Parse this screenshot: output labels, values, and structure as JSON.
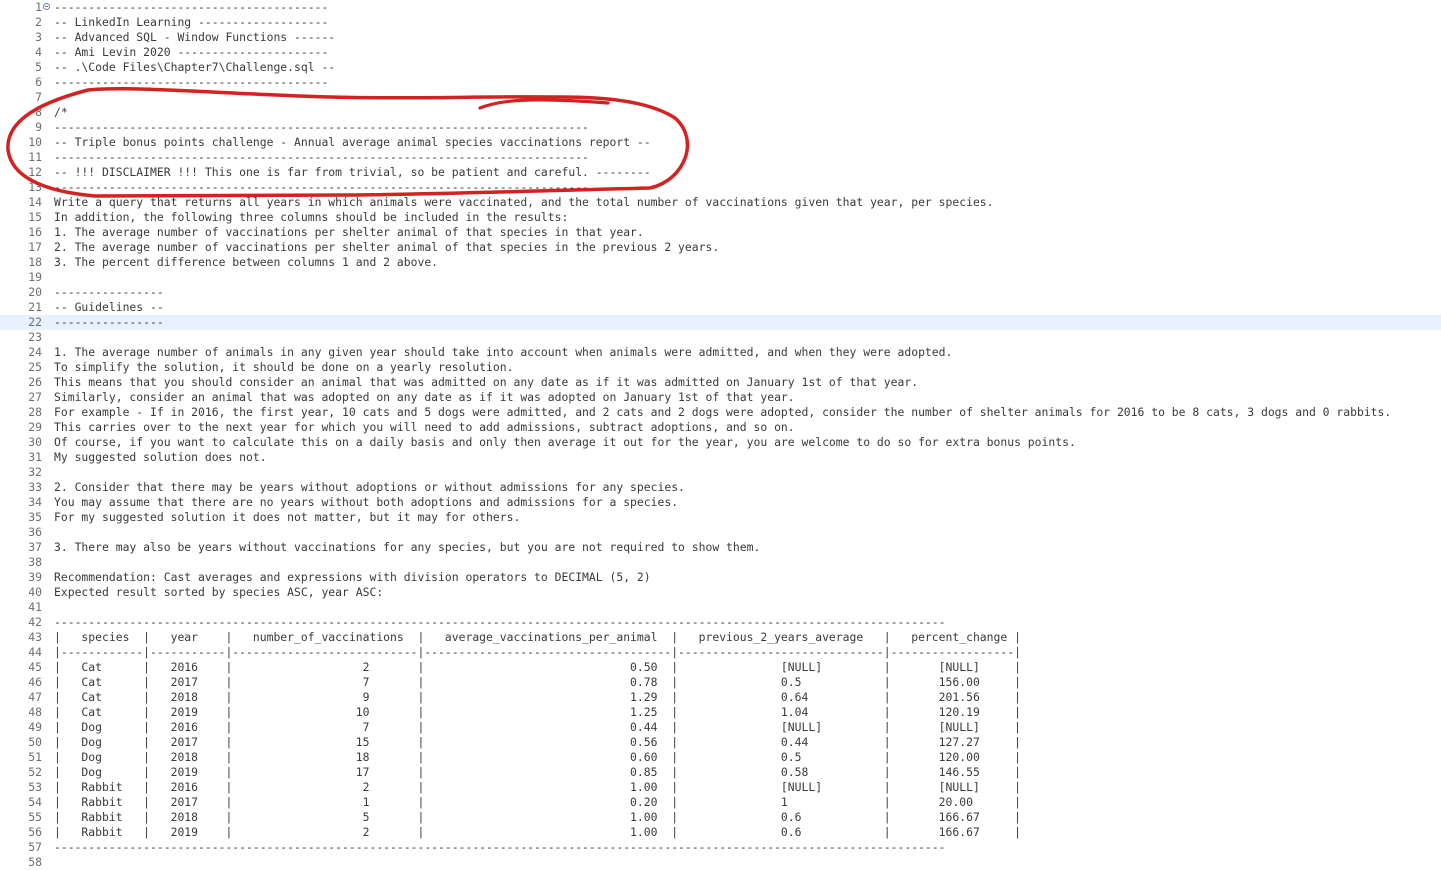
{
  "editor": {
    "fold_marker_line": 1,
    "current_line": 22,
    "lines": [
      {
        "n": "1",
        "text": "----------------------------------------"
      },
      {
        "n": "2",
        "text": "-- LinkedIn Learning -------------------"
      },
      {
        "n": "3",
        "text": "-- Advanced SQL - Window Functions ------"
      },
      {
        "n": "4",
        "text": "-- Ami Levin 2020 ----------------------"
      },
      {
        "n": "5",
        "text": "-- .\\Code Files\\Chapter7\\Challenge.sql --"
      },
      {
        "n": "6",
        "text": "----------------------------------------"
      },
      {
        "n": "7",
        "text": ""
      },
      {
        "n": "8",
        "text": "/*"
      },
      {
        "n": "9",
        "text": "------------------------------------------------------------------------------"
      },
      {
        "n": "10",
        "text": "-- Triple bonus points challenge - Annual average animal species vaccinations report --"
      },
      {
        "n": "11",
        "text": "------------------------------------------------------------------------------"
      },
      {
        "n": "12",
        "text": "-- !!! DISCLAIMER !!! This one is far from trivial, so be patient and careful. --------"
      },
      {
        "n": "13",
        "text": "------------------------------------------------------------------------------"
      },
      {
        "n": "14",
        "text": "Write a query that returns all years in which animals were vaccinated, and the total number of vaccinations given that year, per species."
      },
      {
        "n": "15",
        "text": "In addition, the following three columns should be included in the results:"
      },
      {
        "n": "16",
        "text": "1. The average number of vaccinations per shelter animal of that species in that year."
      },
      {
        "n": "17",
        "text": "2. The average number of vaccinations per shelter animal of that species in the previous 2 years."
      },
      {
        "n": "18",
        "text": "3. The percent difference between columns 1 and 2 above."
      },
      {
        "n": "19",
        "text": ""
      },
      {
        "n": "20",
        "text": "----------------"
      },
      {
        "n": "21",
        "text": "-- Guidelines --"
      },
      {
        "n": "22",
        "text": "----------------"
      },
      {
        "n": "23",
        "text": ""
      },
      {
        "n": "24",
        "text": "1. The average number of animals in any given year should take into account when animals were admitted, and when they were adopted."
      },
      {
        "n": "25",
        "text": "To simplify the solution, it should be done on a yearly resolution."
      },
      {
        "n": "26",
        "text": "This means that you should consider an animal that was admitted on any date as if it was admitted on January 1st of that year."
      },
      {
        "n": "27",
        "text": "Similarly, consider an animal that was adopted on any date as if it was adopted on January 1st of that year."
      },
      {
        "n": "28",
        "text": "For example - If in 2016, the first year, 10 cats and 5 dogs were admitted, and 2 cats and 2 dogs were adopted, consider the number of shelter animals for 2016 to be 8 cats, 3 dogs and 0 rabbits."
      },
      {
        "n": "29",
        "text": "This carries over to the next year for which you will need to add admissions, subtract adoptions, and so on."
      },
      {
        "n": "30",
        "text": "Of course, if you want to calculate this on a daily basis and only then average it out for the year, you are welcome to do so for extra bonus points."
      },
      {
        "n": "31",
        "text": "My suggested solution does not."
      },
      {
        "n": "32",
        "text": ""
      },
      {
        "n": "33",
        "text": "2. Consider that there may be years without adoptions or without admissions for any species."
      },
      {
        "n": "34",
        "text": "You may assume that there are no years without both adoptions and admissions for a species."
      },
      {
        "n": "35",
        "text": "For my suggested solution it does not matter, but it may for others."
      },
      {
        "n": "36",
        "text": ""
      },
      {
        "n": "37",
        "text": "3. There may also be years without vaccinations for any species, but you are not required to show them."
      },
      {
        "n": "38",
        "text": ""
      },
      {
        "n": "39",
        "text": "Recommendation: Cast averages and expressions with division operators to DECIMAL (5, 2)"
      },
      {
        "n": "40",
        "text": "Expected result sorted by species ASC, year ASC:"
      },
      {
        "n": "41",
        "text": ""
      },
      {
        "n": "42",
        "text": "----------------------------------------------------------------------------------------------------------------------------------"
      },
      {
        "n": "43",
        "text": "|   species  |   year    |   number_of_vaccinations  |   average_vaccinations_per_animal  |   previous_2_years_average   |   percent_change |"
      },
      {
        "n": "44",
        "text": "|------------|-----------|---------------------------|------------------------------------|------------------------------|------------------|"
      },
      {
        "n": "45",
        "text": "|   Cat      |   2016    |                   2       |                              0.50  |               [NULL]         |       [NULL]     |"
      },
      {
        "n": "46",
        "text": "|   Cat      |   2017    |                   7       |                              0.78  |               0.5            |       156.00     |"
      },
      {
        "n": "47",
        "text": "|   Cat      |   2018    |                   9       |                              1.29  |               0.64           |       201.56     |"
      },
      {
        "n": "48",
        "text": "|   Cat      |   2019    |                  10       |                              1.25  |               1.04           |       120.19     |"
      },
      {
        "n": "49",
        "text": "|   Dog      |   2016    |                   7       |                              0.44  |               [NULL]         |       [NULL]     |"
      },
      {
        "n": "50",
        "text": "|   Dog      |   2017    |                  15       |                              0.56  |               0.44           |       127.27     |"
      },
      {
        "n": "51",
        "text": "|   Dog      |   2018    |                  18       |                              0.60  |               0.5            |       120.00     |"
      },
      {
        "n": "52",
        "text": "|   Dog      |   2019    |                  17       |                              0.85  |               0.58           |       146.55     |"
      },
      {
        "n": "53",
        "text": "|   Rabbit   |   2016    |                   2       |                              1.00  |               [NULL]         |       [NULL]     |"
      },
      {
        "n": "54",
        "text": "|   Rabbit   |   2017    |                   1       |                              0.20  |               1              |       20.00      |"
      },
      {
        "n": "55",
        "text": "|   Rabbit   |   2018    |                   5       |                              1.00  |               0.6            |       166.67     |"
      },
      {
        "n": "56",
        "text": "|   Rabbit   |   2019    |                   2       |                              1.00  |               0.6            |       166.67     |"
      },
      {
        "n": "57",
        "text": "----------------------------------------------------------------------------------------------------------------------------------"
      },
      {
        "n": "58",
        "text": ""
      }
    ]
  },
  "annotation": {
    "color": "#d42121"
  }
}
